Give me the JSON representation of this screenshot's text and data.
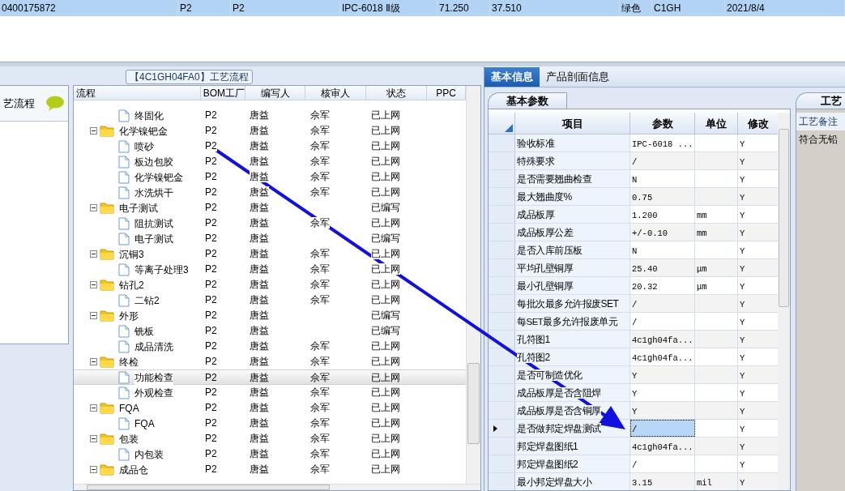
{
  "top_row": {
    "selected": true,
    "cells": [
      "0400175872",
      "P2",
      "P2",
      "IPC-6018 Ⅱ级",
      "71.250",
      "37.510",
      "绿色",
      "C1GH",
      "2021/8/4"
    ]
  },
  "process_panel": {
    "title": "艺流程"
  },
  "flow": {
    "title": "【4C1GH04FA0】工艺流程",
    "columns": [
      "流程",
      "BOM工厂",
      "编写人",
      "核审人",
      "状态",
      "PPC"
    ],
    "rows": [
      {
        "name": "终固化",
        "kind": "leaf",
        "bom": "P2",
        "writer": "唐益",
        "reviewer": "佘军",
        "status": "已上网",
        "selected": false
      },
      {
        "name": "化学镍钯金",
        "kind": "folder",
        "expanded": true,
        "bom": "P2",
        "writer": "唐益",
        "reviewer": "佘军",
        "status": "已上网",
        "selected": false,
        "children": [
          {
            "name": "喷砂",
            "kind": "leaf",
            "bom": "P2",
            "writer": "唐益",
            "reviewer": "佘军",
            "status": "已上网",
            "selected": false
          },
          {
            "name": "板边包胶",
            "kind": "leaf",
            "bom": "P2",
            "writer": "唐益",
            "reviewer": "佘军",
            "status": "已上网",
            "selected": false
          },
          {
            "name": "化学镍钯金",
            "kind": "leaf",
            "bom": "P2",
            "writer": "唐益",
            "reviewer": "佘军",
            "status": "已上网",
            "selected": false
          },
          {
            "name": "水洗烘干",
            "kind": "leaf",
            "bom": "P2",
            "writer": "唐益",
            "reviewer": "佘军",
            "status": "已上网",
            "selected": false
          }
        ]
      },
      {
        "name": "电子测试",
        "kind": "folder",
        "expanded": true,
        "bom": "P2",
        "writer": "唐益",
        "status": "已编写",
        "selected": false,
        "children": [
          {
            "name": "阻抗测试",
            "kind": "leaf",
            "bom": "P2",
            "writer": "唐益",
            "reviewer": "佘军",
            "status": "已上网",
            "selected": false
          },
          {
            "name": "电子测试",
            "kind": "leaf",
            "bom": "P2",
            "writer": "唐益",
            "status": "已编写",
            "selected": false
          }
        ]
      },
      {
        "name": "沉铜3",
        "kind": "folder",
        "expanded": true,
        "bom": "P2",
        "writer": "唐益",
        "reviewer": "佘军",
        "status": "已上网",
        "selected": false,
        "children": [
          {
            "name": "等离子处理3",
            "kind": "leaf",
            "bom": "P2",
            "writer": "唐益",
            "reviewer": "佘军",
            "status": "已上网",
            "selected": false
          }
        ]
      },
      {
        "name": "钻孔2",
        "kind": "folder",
        "expanded": true,
        "bom": "P2",
        "writer": "唐益",
        "reviewer": "佘军",
        "status": "已上网",
        "selected": false,
        "children": [
          {
            "name": "二钻2",
            "kind": "leaf",
            "bom": "P2",
            "writer": "唐益",
            "reviewer": "佘军",
            "status": "已上网",
            "selected": false
          }
        ]
      },
      {
        "name": "外形",
        "kind": "folder",
        "expanded": true,
        "bom": "P2",
        "writer": "唐益",
        "status": "已编写",
        "selected": false,
        "children": [
          {
            "name": "铣板",
            "kind": "leaf",
            "bom": "P2",
            "writer": "唐益",
            "status": "已编写",
            "selected": false
          },
          {
            "name": "成品清洗",
            "kind": "leaf",
            "bom": "P2",
            "writer": "唐益",
            "reviewer": "佘军",
            "status": "已上网",
            "selected": false
          }
        ]
      },
      {
        "name": "终检",
        "kind": "folder",
        "expanded": true,
        "bom": "P2",
        "writer": "唐益",
        "reviewer": "佘军",
        "status": "已上网",
        "selected": false,
        "children": [
          {
            "name": "功能检查",
            "kind": "leaf",
            "bom": "P2",
            "writer": "唐益",
            "reviewer": "佘军",
            "status": "已上网",
            "selected": true
          },
          {
            "name": "外观检查",
            "kind": "leaf",
            "bom": "P2",
            "writer": "唐益",
            "reviewer": "佘军",
            "status": "已上网",
            "selected": false
          }
        ]
      },
      {
        "name": "FQA",
        "kind": "folder",
        "expanded": true,
        "bom": "P2",
        "writer": "唐益",
        "reviewer": "佘军",
        "status": "已上网",
        "selected": false,
        "children": [
          {
            "name": "FQA",
            "kind": "leaf",
            "bom": "P2",
            "writer": "唐益",
            "reviewer": "佘军",
            "status": "已上网",
            "selected": false
          }
        ]
      },
      {
        "name": "包装",
        "kind": "folder",
        "expanded": true,
        "bom": "P2",
        "writer": "唐益",
        "reviewer": "佘军",
        "status": "已上网",
        "selected": false,
        "children": [
          {
            "name": "内包装",
            "kind": "leaf",
            "bom": "P2",
            "writer": "唐益",
            "reviewer": "佘军",
            "status": "已上网",
            "selected": false
          }
        ]
      },
      {
        "name": "成品仓",
        "kind": "folder",
        "expanded": true,
        "bom": "P2",
        "writer": "唐益",
        "reviewer": "佘军",
        "status": "已上网",
        "selected": false
      }
    ]
  },
  "tabs": [
    {
      "label": "基本信息",
      "selected": true
    },
    {
      "label": "产品剖面信息",
      "selected": false
    }
  ],
  "params": {
    "tab": "基本参数",
    "columns": [
      "项目",
      "参数",
      "单位",
      "修改"
    ],
    "rows": [
      {
        "item": "验收标准",
        "value": "IPC-6018 ...",
        "modify": "Y",
        "selected": false
      },
      {
        "item": "特殊要求",
        "value": "/",
        "modify": "Y",
        "selected": false
      },
      {
        "item": "是否需要翘曲检查",
        "value": "N",
        "modify": "Y",
        "selected": false
      },
      {
        "item": "最大翘曲度%",
        "value": "0.75",
        "modify": "Y",
        "selected": false
      },
      {
        "item": "成品板厚",
        "value": "1.200",
        "unit": "mm",
        "modify": "Y",
        "selected": false
      },
      {
        "item": "成品板厚公差",
        "value": "+/-0.10",
        "unit": "mm",
        "modify": "Y",
        "selected": false
      },
      {
        "item": "是否入库前压板",
        "value": "N",
        "modify": "Y",
        "selected": false
      },
      {
        "item": "平均孔壁铜厚",
        "value": "25.40",
        "unit": "μm",
        "modify": "Y",
        "selected": false
      },
      {
        "item": "最小孔壁铜厚",
        "value": "20.32",
        "unit": "μm",
        "modify": "Y",
        "selected": false
      },
      {
        "item": "每批次最多允许报废SET",
        "value": "/",
        "modify": "Y",
        "selected": false
      },
      {
        "item": "每SET最多允许报废单元",
        "value": "/",
        "modify": "Y",
        "selected": false
      },
      {
        "item": "孔符图1",
        "value": "4c1gh04fa...",
        "modify": "Y",
        "selected": false
      },
      {
        "item": "孔符图2",
        "value": "4c1gh04fa...",
        "modify": "Y",
        "selected": false
      },
      {
        "item": "是否可制造优化",
        "value": "Y",
        "modify": "Y",
        "selected": false
      },
      {
        "item": "成品板厚是否含阻焊",
        "value": "Y",
        "modify": "Y",
        "selected": false
      },
      {
        "item": "成品板厚是否含铜厚",
        "value": "Y",
        "modify": "Y",
        "selected": false
      },
      {
        "item": "是否做邦定焊盘测试",
        "value": "/",
        "modify": "Y",
        "selected": true
      },
      {
        "item": "邦定焊盘图纸1",
        "value": "4c1gh04fa...",
        "modify": "Y",
        "selected": false
      },
      {
        "item": "邦定焊盘图纸2",
        "value": "/",
        "modify": "Y",
        "selected": false
      },
      {
        "item": "最小邦定焊盘大小",
        "value": "3.15",
        "unit": "mil",
        "modify": "Y",
        "selected": false
      }
    ]
  },
  "remarks": {
    "tab": "工艺",
    "column": "工艺备注",
    "text": "符合无铅"
  }
}
